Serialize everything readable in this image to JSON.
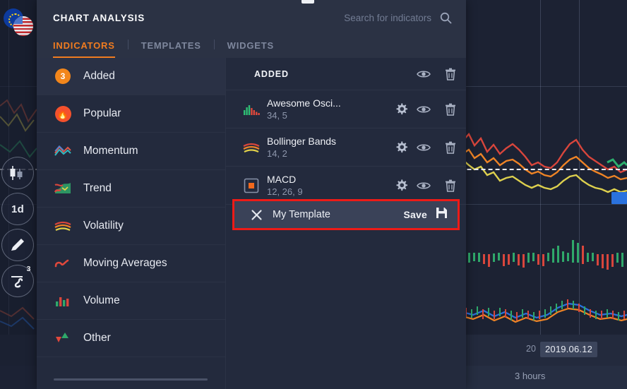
{
  "instrument": {
    "pair": "EUR/USD",
    "left_flag": "eu-flag-icon",
    "right_flag": "us-flag-icon"
  },
  "left_rail": {
    "buttons": [
      {
        "name": "chart-type-button",
        "icon": "candlestick-icon",
        "label": ""
      },
      {
        "name": "timeframe-button",
        "icon": "timeframe-icon",
        "label": "1d"
      },
      {
        "name": "drawing-tools-button",
        "icon": "pencil-icon",
        "label": ""
      },
      {
        "name": "indicators-button",
        "icon": "indicator-wave-icon",
        "label": "",
        "badge": "3"
      }
    ]
  },
  "panel": {
    "title": "CHART ANALYSIS",
    "search": {
      "placeholder": "Search for indicators",
      "icon": "search-icon"
    },
    "tabs": [
      {
        "label": "INDICATORS",
        "active": true
      },
      {
        "label": "TEMPLATES",
        "active": false
      },
      {
        "label": "WIDGETS",
        "active": false
      }
    ],
    "categories": [
      {
        "label": "Added",
        "icon": "count-badge",
        "badge": "3",
        "selected": true
      },
      {
        "label": "Popular",
        "icon": "flame-icon",
        "selected": false
      },
      {
        "label": "Momentum",
        "icon": "momentum-icon",
        "selected": false
      },
      {
        "label": "Trend",
        "icon": "trend-icon",
        "selected": false
      },
      {
        "label": "Volatility",
        "icon": "volatility-waves-icon",
        "selected": false
      },
      {
        "label": "Moving Averages",
        "icon": "wave-line-icon",
        "selected": false
      },
      {
        "label": "Volume",
        "icon": "volume-bars-icon",
        "selected": false
      },
      {
        "label": "Other",
        "icon": "arrows-icon",
        "selected": false
      }
    ],
    "added": {
      "header": "ADDED",
      "header_actions": [
        {
          "name": "visibility-toggle-all",
          "icon": "eye-icon"
        },
        {
          "name": "delete-all",
          "icon": "trash-icon"
        }
      ],
      "items": [
        {
          "name": "Awesome Osci...",
          "params": "34, 5",
          "icon": "awesome-oscillator-icon",
          "actions": [
            {
              "name": "settings",
              "icon": "gear-icon"
            },
            {
              "name": "visibility",
              "icon": "eye-icon"
            },
            {
              "name": "delete",
              "icon": "trash-icon"
            }
          ]
        },
        {
          "name": "Bollinger Bands",
          "params": "14, 2",
          "icon": "bollinger-bands-icon",
          "actions": [
            {
              "name": "settings",
              "icon": "gear-icon"
            },
            {
              "name": "visibility",
              "icon": "eye-icon"
            },
            {
              "name": "delete",
              "icon": "trash-icon"
            }
          ]
        },
        {
          "name": "MACD",
          "params": "12, 26, 9",
          "icon": "macd-icon",
          "actions": [
            {
              "name": "settings",
              "icon": "gear-icon"
            },
            {
              "name": "visibility",
              "icon": "eye-icon"
            },
            {
              "name": "delete",
              "icon": "trash-icon"
            }
          ]
        }
      ],
      "template_row": {
        "close_icon": "close-x-icon",
        "label": "My Template",
        "save_label": "Save",
        "save_icon": "floppy-disk-icon",
        "highlight_color": "#ee1b17"
      }
    }
  },
  "chart": {
    "date_tooltip": "2019.06.12",
    "partial_axis_label": "20",
    "timeframe_label": "3 hours",
    "price_marker_color": "#2a72de"
  },
  "colors": {
    "accent": "#f07c20",
    "panel_bg": "#232a3d",
    "panel_header_bg": "#2b3244",
    "chart_bg": "#1c2233",
    "highlight": "#ee1b17",
    "badge_orange": "#f2861b",
    "up_green": "#1fbf6b",
    "down_red": "#e8443c"
  },
  "chart_data": {
    "type": "line",
    "title": "",
    "series": [
      {
        "name": "upper-band",
        "color": "#e8443c"
      },
      {
        "name": "middle-band",
        "color": "#f08a2e"
      },
      {
        "name": "lower-band",
        "color": "#e0d04a"
      }
    ],
    "price_line_value": "dashed-white",
    "grid": true,
    "xlabel": "",
    "ylabel": ""
  }
}
